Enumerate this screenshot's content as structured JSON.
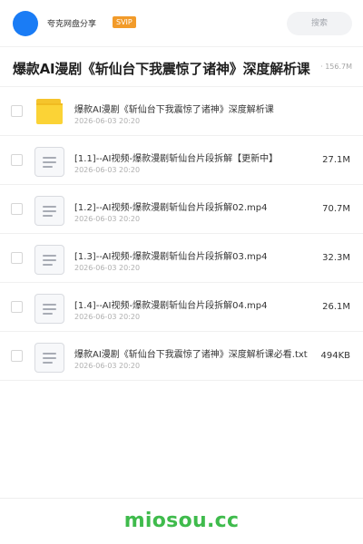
{
  "header": {
    "brand": "夸克网盘分享",
    "badge": "SVIP",
    "search_placeholder": "搜索"
  },
  "share": {
    "title": "爆款AI漫剧《斩仙台下我震惊了诸神》深度解析课",
    "meta": "· 156.7M"
  },
  "files": [
    {
      "type": "folder",
      "icon": "folder-icon",
      "name": "爆款AI漫剧《斩仙台下我震惊了诸神》深度解析课",
      "date": "2026-06-03 20:20",
      "size": ""
    },
    {
      "type": "file",
      "icon": "document-icon",
      "name": "[1.1]--AI视频-爆款漫剧斩仙台片段拆解【更新中】",
      "date": "2026-06-03 20:20",
      "size": "27.1M"
    },
    {
      "type": "file",
      "icon": "document-icon",
      "name": "[1.2]--AI视频-爆款漫剧斩仙台片段拆解02.mp4",
      "date": "2026-06-03 20:20",
      "size": "70.7M"
    },
    {
      "type": "file",
      "icon": "document-icon",
      "name": "[1.3]--AI视频-爆款漫剧斩仙台片段拆解03.mp4",
      "date": "2026-06-03 20:20",
      "size": "32.3M"
    },
    {
      "type": "file",
      "icon": "document-icon",
      "name": "[1.4]--AI视频-爆款漫剧斩仙台片段拆解04.mp4",
      "date": "2026-06-03 20:20",
      "size": "26.1M"
    },
    {
      "type": "file",
      "icon": "document-icon",
      "name": "爆款AI漫剧《斩仙台下我震惊了诸神》深度解析课必看.txt",
      "date": "2026-06-03 20:20",
      "size": "494KB"
    }
  ],
  "watermark": "miosou.cc",
  "colors": {
    "avatar": "#1a7cf5",
    "badge": "#f29b2a",
    "folder": "#fbd336",
    "watermark": "#3fbb4c"
  }
}
